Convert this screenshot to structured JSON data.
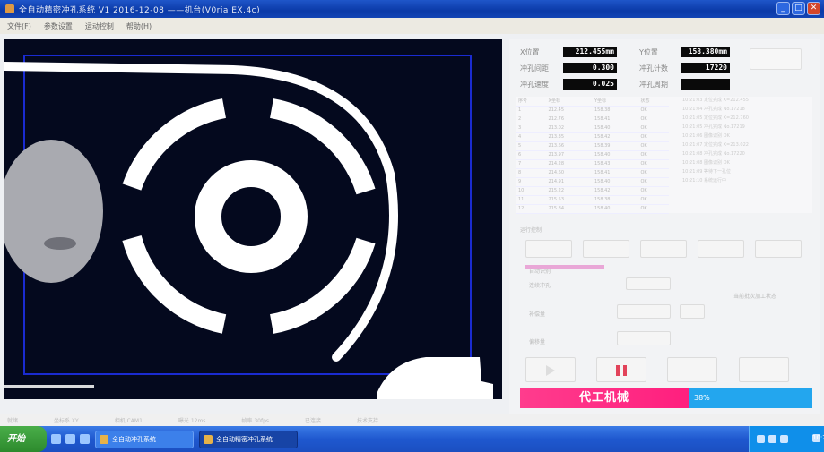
{
  "window": {
    "title": "全自动精密冲孔系统 V1  2016-12-08 ——机台(V0ria  EX.4c)",
    "buttons": {
      "minimize": "_",
      "maximize": "□",
      "close": "✕"
    }
  },
  "menu": [
    "文件(F)",
    "参数设置",
    "运动控制",
    "帮助(H)"
  ],
  "readouts": [
    {
      "label": "X位置",
      "value": "212.455mm"
    },
    {
      "label": "Y位置",
      "value": "158.380mm"
    },
    {
      "label": "冲孔间距",
      "value": "0.300"
    },
    {
      "label": "冲孔计数",
      "value": "17220"
    },
    {
      "label": "冲孔速度",
      "value": "0.025"
    },
    {
      "label": "冲孔周期",
      "value": ""
    }
  ],
  "position_table": {
    "headers": [
      "序号",
      "X坐标",
      "Y坐标",
      "状态"
    ],
    "rows": [
      [
        "1",
        "212.45",
        "158.38",
        "OK"
      ],
      [
        "2",
        "212.76",
        "158.41",
        "OK"
      ],
      [
        "3",
        "213.02",
        "158.40",
        "OK"
      ],
      [
        "4",
        "213.35",
        "158.42",
        "OK"
      ],
      [
        "5",
        "213.66",
        "158.39",
        "OK"
      ],
      [
        "6",
        "213.97",
        "158.40",
        "OK"
      ],
      [
        "7",
        "214.28",
        "158.43",
        "OK"
      ],
      [
        "8",
        "214.60",
        "158.41",
        "OK"
      ],
      [
        "9",
        "214.91",
        "158.40",
        "OK"
      ],
      [
        "10",
        "215.22",
        "158.42",
        "OK"
      ],
      [
        "11",
        "215.53",
        "158.38",
        "OK"
      ],
      [
        "12",
        "215.84",
        "158.40",
        "OK"
      ]
    ]
  },
  "log": [
    "10:21:03  定位完成 X=212.455",
    "10:21:04  冲孔完成 No.17218",
    "10:21:05  定位完成 X=212.760",
    "10:21:05  冲孔完成 No.17219",
    "10:21:06  图像识别 OK",
    "10:21:07  定位完成 X=213.022",
    "10:21:08  冲孔完成 No.17220",
    "10:21:08  图像识别 OK",
    "10:21:09  等待下一孔位",
    "10:21:10  系统运行中"
  ],
  "progress": 0.55,
  "controls": {
    "section_label": "运行控制",
    "option1": "自动识别",
    "option2": "连续冲孔",
    "field1": "补偿量",
    "field2": "偏移量",
    "note": "当前批次加工状态"
  },
  "banner": {
    "left": "代工机械",
    "right": "38%"
  },
  "status_bar": [
    "就绪",
    "坐标系 XY",
    "相机 CAM1",
    "曝光 12ms",
    "帧率 30fps",
    "已连接",
    "技术支持"
  ],
  "taskbar": {
    "start": "开始",
    "tasks": [
      "全自动冲孔系统",
      "全自动精密冲孔系统"
    ],
    "clock": "10:21"
  },
  "colors": {
    "banner_pink": "#ff2a84",
    "banner_blue": "#23a6ee",
    "view_bg": "#04091e",
    "roi": "#1a2bd1"
  }
}
